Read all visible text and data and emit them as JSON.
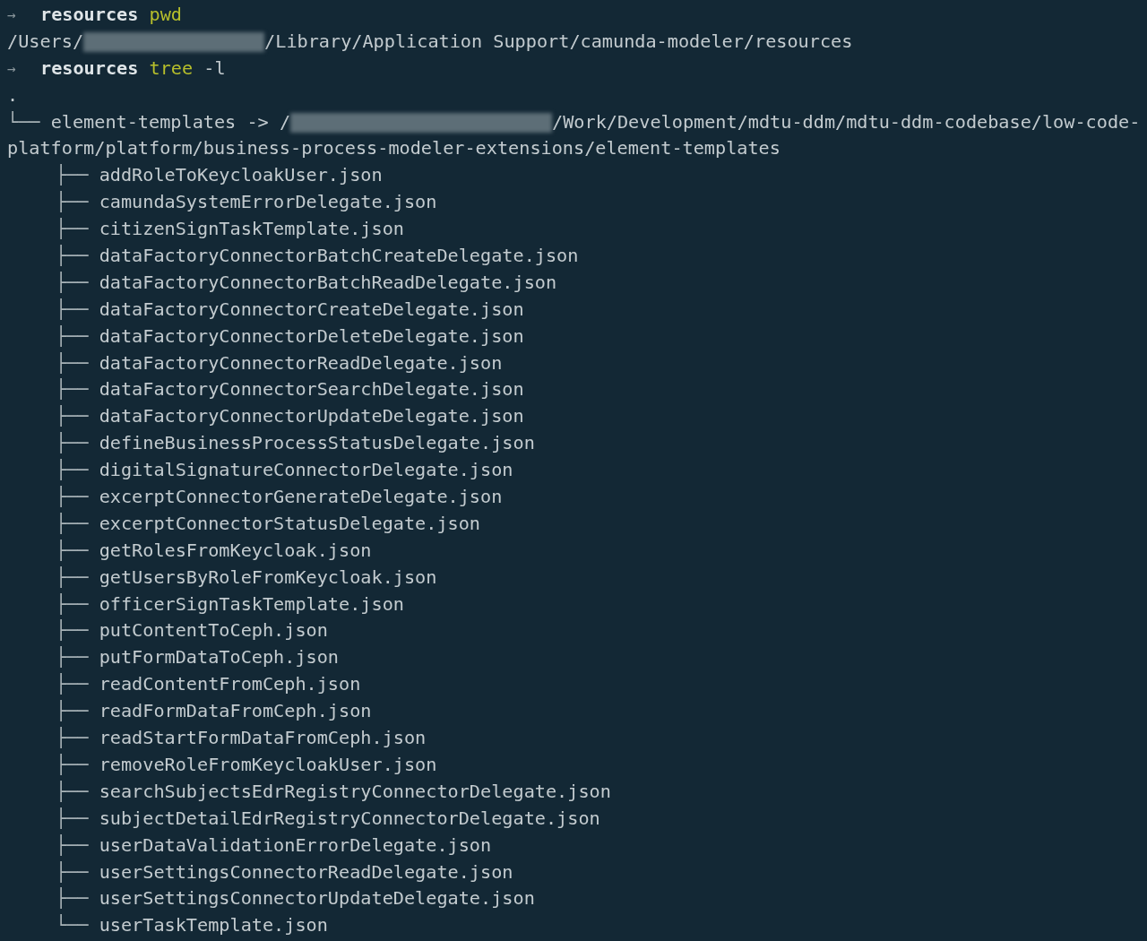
{
  "commands": [
    {
      "prompt": "→",
      "directory": "resources",
      "command": "pwd",
      "output": [
        {
          "kind": "redacted_path",
          "before": "/Users/",
          "after": "/Library/Application Support/camunda-modeler/resources"
        }
      ]
    },
    {
      "prompt": "→",
      "directory": "resources",
      "command": "tree",
      "args": "-l"
    }
  ],
  "tree": {
    "root": ".",
    "link": {
      "branch": "└──",
      "name": "element-templates",
      "arrow": "->",
      "target_start": "/",
      "target_line_1": "/Work/Development/mdtu-ddm/mdtu-ddm-codebase/low-code-",
      "target_line_2": "platform/platform/business-process-modeler-extensions/element-templates"
    },
    "children": [
      {
        "branch": "├──",
        "name": "addRoleToKeycloakUser.json"
      },
      {
        "branch": "├──",
        "name": "camundaSystemErrorDelegate.json"
      },
      {
        "branch": "├──",
        "name": "citizenSignTaskTemplate.json"
      },
      {
        "branch": "├──",
        "name": "dataFactoryConnectorBatchCreateDelegate.json"
      },
      {
        "branch": "├──",
        "name": "dataFactoryConnectorBatchReadDelegate.json"
      },
      {
        "branch": "├──",
        "name": "dataFactoryConnectorCreateDelegate.json"
      },
      {
        "branch": "├──",
        "name": "dataFactoryConnectorDeleteDelegate.json"
      },
      {
        "branch": "├──",
        "name": "dataFactoryConnectorReadDelegate.json"
      },
      {
        "branch": "├──",
        "name": "dataFactoryConnectorSearchDelegate.json"
      },
      {
        "branch": "├──",
        "name": "dataFactoryConnectorUpdateDelegate.json"
      },
      {
        "branch": "├──",
        "name": "defineBusinessProcessStatusDelegate.json"
      },
      {
        "branch": "├──",
        "name": "digitalSignatureConnectorDelegate.json"
      },
      {
        "branch": "├──",
        "name": "excerptConnectorGenerateDelegate.json"
      },
      {
        "branch": "├──",
        "name": "excerptConnectorStatusDelegate.json"
      },
      {
        "branch": "├──",
        "name": "getRolesFromKeycloak.json"
      },
      {
        "branch": "├──",
        "name": "getUsersByRoleFromKeycloak.json"
      },
      {
        "branch": "├──",
        "name": "officerSignTaskTemplate.json"
      },
      {
        "branch": "├──",
        "name": "putContentToCeph.json"
      },
      {
        "branch": "├──",
        "name": "putFormDataToCeph.json"
      },
      {
        "branch": "├──",
        "name": "readContentFromCeph.json"
      },
      {
        "branch": "├──",
        "name": "readFormDataFromCeph.json"
      },
      {
        "branch": "├──",
        "name": "readStartFormDataFromCeph.json"
      },
      {
        "branch": "├──",
        "name": "removeRoleFromKeycloakUser.json"
      },
      {
        "branch": "├──",
        "name": "searchSubjectsEdrRegistryConnectorDelegate.json"
      },
      {
        "branch": "├──",
        "name": "subjectDetailEdrRegistryConnectorDelegate.json"
      },
      {
        "branch": "├──",
        "name": "userDataValidationErrorDelegate.json"
      },
      {
        "branch": "├──",
        "name": "userSettingsConnectorReadDelegate.json"
      },
      {
        "branch": "├──",
        "name": "userSettingsConnectorUpdateDelegate.json"
      },
      {
        "branch": "└──",
        "name": "userTaskTemplate.json"
      }
    ]
  }
}
